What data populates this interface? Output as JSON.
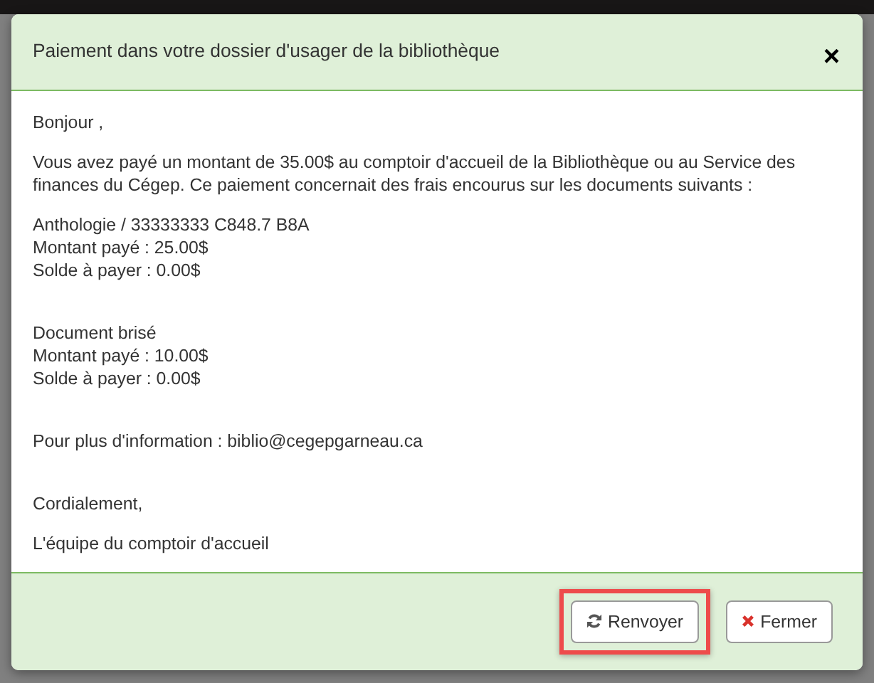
{
  "dialog": {
    "title": "Paiement dans votre dossier d'usager de la bibliothèque",
    "close": "×",
    "body": [
      {
        "kind": "text",
        "lines": [
          "Bonjour ,"
        ]
      },
      {
        "kind": "text",
        "lines": [
          "Vous avez payé un montant de 35.00$ au comptoir d'accueil de la Bibliothèque ou au Service des finances du Cégep. Ce paiement concernait des frais encourus sur les documents suivants :"
        ]
      },
      {
        "kind": "fee",
        "lines": [
          "Anthologie / 33333333 C848.7 B8A",
          "Montant payé : 25.00$",
          "Solde à payer : 0.00$"
        ]
      },
      {
        "kind": "fee",
        "lines": [
          "Document brisé",
          "Montant payé : 10.00$",
          "Solde à payer : 0.00$"
        ]
      },
      {
        "kind": "fee",
        "lines": [
          "Pour plus d'information : biblio@cegepgarneau.ca"
        ]
      },
      {
        "kind": "text",
        "lines": [
          "Cordialement,"
        ]
      },
      {
        "kind": "text",
        "lines": [
          "L'équipe du comptoir d'accueil"
        ]
      }
    ],
    "buttons": [
      {
        "label": "Renvoyer",
        "kind": "resend",
        "highlighted": true
      },
      {
        "label": "Fermer",
        "kind": "close",
        "highlighted": false
      }
    ]
  }
}
